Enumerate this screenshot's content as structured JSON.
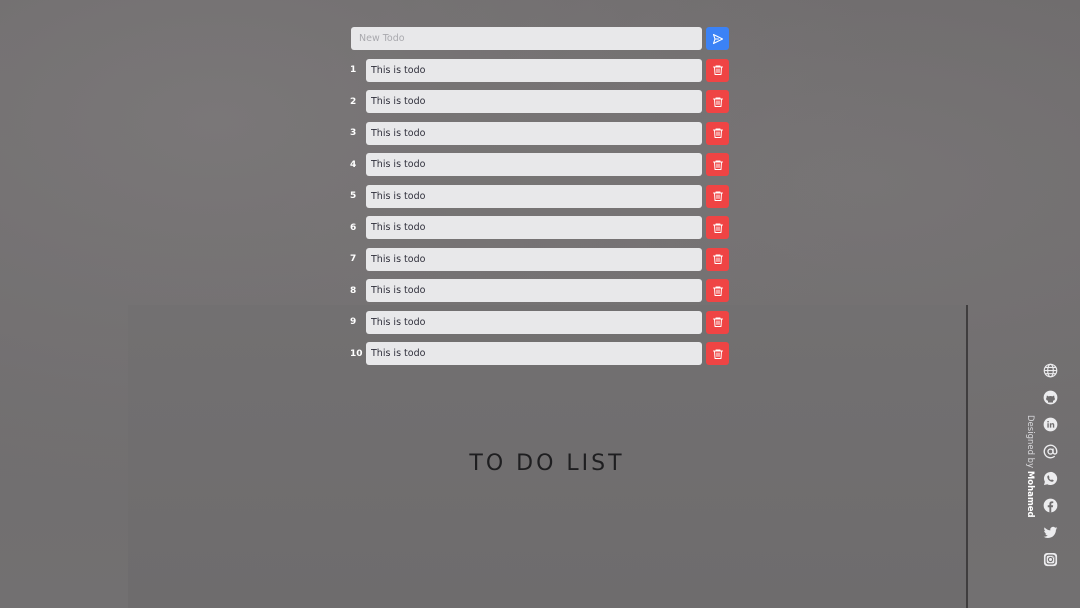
{
  "new_todo": {
    "placeholder": "New Todo",
    "value": ""
  },
  "todos": [
    {
      "num": "1",
      "text": "This is todo"
    },
    {
      "num": "2",
      "text": "This is todo"
    },
    {
      "num": "3",
      "text": "This is todo"
    },
    {
      "num": "4",
      "text": "This is todo"
    },
    {
      "num": "5",
      "text": "This is todo"
    },
    {
      "num": "6",
      "text": "This is todo"
    },
    {
      "num": "7",
      "text": "This is todo"
    },
    {
      "num": "8",
      "text": "This is todo"
    },
    {
      "num": "9",
      "text": "This is todo"
    },
    {
      "num": "10",
      "text": "This is todo"
    }
  ],
  "background_text": "TO DO LIST",
  "credit": {
    "prefix": "Designed by",
    "name": "Mohamed"
  },
  "social_icons": [
    "globe-icon",
    "github-icon",
    "linkedin-icon",
    "at-sign-icon",
    "whatsapp-icon",
    "facebook-icon",
    "twitter-icon",
    "instagram-icon"
  ],
  "colors": {
    "send": "#3b82f6",
    "delete": "#ef4444",
    "input_bg": "#e8e8ea"
  }
}
